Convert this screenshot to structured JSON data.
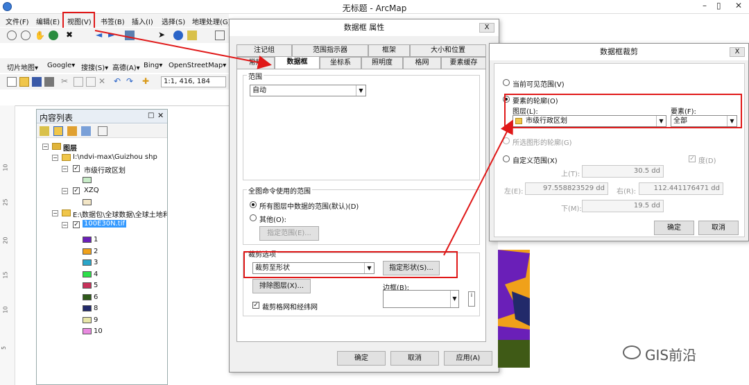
{
  "window": {
    "title": "无标题 - ArcMap"
  },
  "menu": [
    "文件(F)",
    "编辑(E)",
    "视图(V)",
    "书签(B)",
    "插入(I)",
    "选择(S)",
    "地理处理(G)"
  ],
  "toolbar2": {
    "items": [
      "切片地图▾",
      "Google▾",
      "搜搜(S)▾",
      "高德(A)▾",
      "Bing▾",
      "OpenStreetMap▾"
    ]
  },
  "toolbar3": {
    "scale": "1:1, 416, 184"
  },
  "ruler": [
    "10",
    "25",
    "20",
    "15",
    "10",
    "5"
  ],
  "toc": {
    "title": "内容列表",
    "layers_root": "图层",
    "folder1": "I:\\ndvi-max\\Guizhou shp",
    "layer1": "市级行政区划",
    "layer2": "XZQ",
    "folder2": "E:\\数据包\\全球数据\\全球土地利",
    "raster": "100E30N.tif",
    "classes": [
      {
        "label": "1",
        "color": "#6a1fb8"
      },
      {
        "label": "2",
        "color": "#f0a11a"
      },
      {
        "label": "3",
        "color": "#2aa6c9"
      },
      {
        "label": "4",
        "color": "#2de04a"
      },
      {
        "label": "5",
        "color": "#c8315a"
      },
      {
        "label": "6",
        "color": "#2f5a1a"
      },
      {
        "label": "8",
        "color": "#222a6a"
      },
      {
        "label": "9",
        "color": "#e8e6a8"
      },
      {
        "label": "10",
        "color": "#e98ae0"
      }
    ]
  },
  "props": {
    "title": "数据框 属性",
    "close": "X",
    "tabs_top": [
      "注记组",
      "范围指示器",
      "框架",
      "大小和位置"
    ],
    "tabs_bottom": [
      "常规",
      "数据框",
      "坐标系",
      "照明度",
      "格网",
      "要素缓存"
    ],
    "extent_group": "范围",
    "extent_value": "自动",
    "fullextent_group": "全图命令使用的范围",
    "opt_all": "所有图层中数据的范围(默认)(D)",
    "opt_other": "其他(O):",
    "specify_extent": "指定范围(E)...",
    "clip_group": "裁剪选项",
    "clip_value": "裁剪至形状",
    "specify_shape": "指定形状(S)...",
    "exclude_layers": "排除图层(X)...",
    "border_label": "边框(B):",
    "clip_grid": "裁剪格网和经纬网",
    "ok": "确定",
    "cancel": "取消",
    "apply": "应用(A)"
  },
  "clip": {
    "title": "数据框裁剪",
    "close": "X",
    "opt_current": "当前可见范围(V)",
    "opt_outline": "要素的轮廓(O)",
    "layer_label": "图层(L):",
    "feature_label": "要素(F):",
    "layer_value": "市级行政区划",
    "feature_value": "全部",
    "opt_selected": "所选图形的轮廓(G)",
    "opt_custom": "自定义范围(X)",
    "degree": "度(D)",
    "top_label": "上(T):",
    "top_value": "30.5 dd",
    "left_label": "左(E):",
    "left_value": "97.558823529 dd",
    "right_label": "右(R):",
    "right_value": "112.441176471 dd",
    "bottom_label": "下(M):",
    "bottom_value": "19.5 dd",
    "ok": "确定",
    "cancel": "取消"
  },
  "watermark": "GIS前沿",
  "colors": {
    "annotation_red": "#e01818",
    "selected_layer": "#3399ff"
  }
}
